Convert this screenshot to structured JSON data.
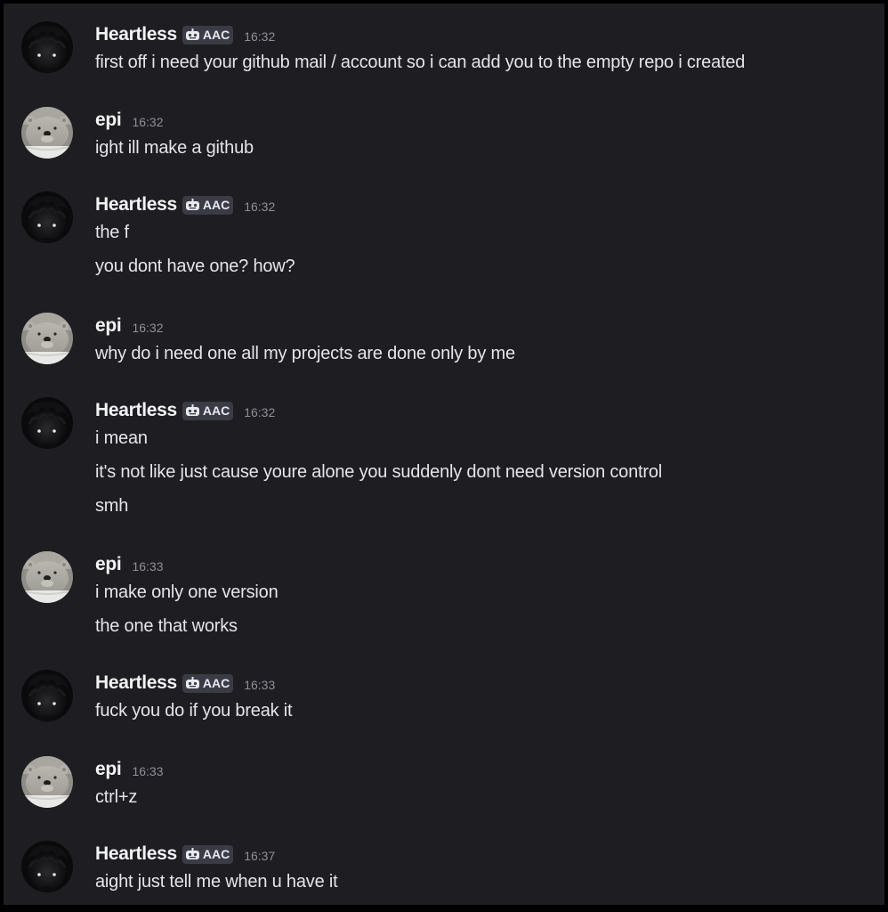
{
  "colors": {
    "background": "#1d1d22",
    "username": "#f2f3f5",
    "message_text": "#e4e5ea",
    "timestamp": "#8e9098",
    "badge_bg": "#3a3b44"
  },
  "messages": [
    {
      "author": "Heartless",
      "avatar": "dark-avatar",
      "badge": "AAC",
      "time": "16:32",
      "lines": [
        "first off i need your github mail / account so i can add you to the empty repo i created"
      ]
    },
    {
      "author": "epi",
      "avatar": "polar-bear-avatar",
      "time": "16:32",
      "lines": [
        "ight ill make a github"
      ]
    },
    {
      "author": "Heartless",
      "avatar": "dark-avatar",
      "badge": "AAC",
      "time": "16:32",
      "lines": [
        "the f",
        "you dont have one? how?"
      ]
    },
    {
      "author": "epi",
      "avatar": "polar-bear-avatar",
      "time": "16:32",
      "lines": [
        "why do i need one all my projects are done only by me"
      ]
    },
    {
      "author": "Heartless",
      "avatar": "dark-avatar",
      "badge": "AAC",
      "time": "16:32",
      "lines": [
        "i mean",
        "it's not like just cause youre alone you suddenly dont need version control",
        "smh"
      ]
    },
    {
      "author": "epi",
      "avatar": "polar-bear-avatar",
      "time": "16:33",
      "lines": [
        "i make only one version",
        "the one that works"
      ]
    },
    {
      "author": "Heartless",
      "avatar": "dark-avatar",
      "badge": "AAC",
      "time": "16:33",
      "lines": [
        "fuck you do if you break it"
      ]
    },
    {
      "author": "epi",
      "avatar": "polar-bear-avatar",
      "time": "16:33",
      "lines": [
        "ctrl+z"
      ]
    },
    {
      "author": "Heartless",
      "avatar": "dark-avatar",
      "badge": "AAC",
      "time": "16:37",
      "lines": [
        "aight just tell me when u have it"
      ]
    }
  ]
}
